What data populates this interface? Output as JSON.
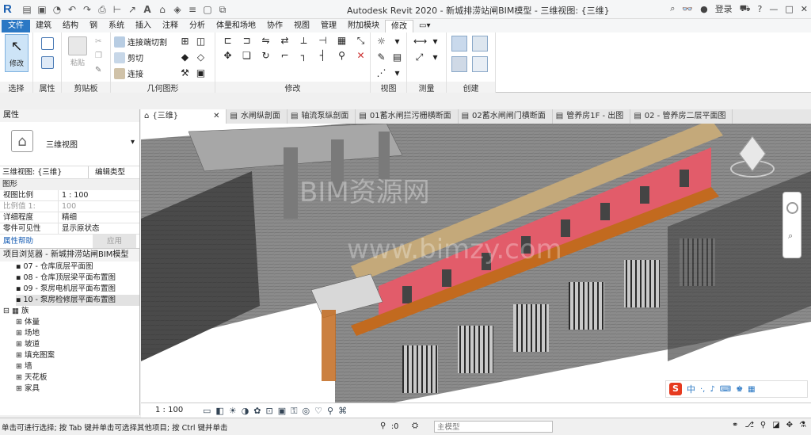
{
  "app": {
    "title": "Autodesk Revit 2020 - 新城排涝站闸BIM模型 - 三维视图: {三维}",
    "logo": "R",
    "user": "登录"
  },
  "ribbon_tabs": [
    "文件",
    "建筑",
    "结构",
    "钢",
    "系统",
    "插入",
    "注释",
    "分析",
    "体量和场地",
    "协作",
    "视图",
    "管理",
    "附加模块",
    "修改"
  ],
  "ribbon": {
    "select_label": "修改",
    "select_panel": "选择",
    "props_panel": "属性",
    "clipboard_paste": "粘贴",
    "clipboard_panel": "剪贴板",
    "geom_items": [
      "连接端切割",
      "剪切",
      "连接"
    ],
    "geom_panel": "几何图形",
    "modify_panel": "修改",
    "view_panel": "视图",
    "measure_panel": "测量",
    "create_panel": "创建"
  },
  "view_tabs": [
    "{三维}",
    "水闸纵剖面",
    "轴流泵纵剖面",
    "01蓄水闸拦污栅横断面",
    "02蓄水闸闸门横断面",
    "管养房1F - 出图",
    "02 - 管养房二层平面图"
  ],
  "properties": {
    "header": "属性",
    "type_name": "三维视图",
    "selector": "三维视图: {三维}",
    "edit_type": "编辑类型",
    "group": "图形",
    "rows": [
      {
        "k": "视图比例",
        "v": "1 : 100"
      },
      {
        "k": "比例值 1:",
        "v": "100"
      },
      {
        "k": "详细程度",
        "v": "精细"
      },
      {
        "k": "零件可见性",
        "v": "显示原状态"
      }
    ],
    "help": "属性帮助",
    "apply": "应用"
  },
  "browser": {
    "title": "项目浏览器 - 新城排涝站闸BIM模型",
    "items": [
      "07 - 仓库底层平面图",
      "08 - 仓库顶层梁平面布置图",
      "09 - 泵房电机层平面布置图",
      "10 - 泵房检修层平面布置图"
    ],
    "family_root": "族",
    "families": [
      "体量",
      "场地",
      "坡道",
      "填充图案",
      "墙",
      "天花板",
      "家具"
    ]
  },
  "watermark": {
    "cn": "BIM资源网",
    "url": "www.bimzy.com"
  },
  "view_control": {
    "scale": "1 : 100"
  },
  "status": {
    "hint": "单击可进行选择; 按 Tab 键并单击可选择其他项目; 按 Ctrl 键并单击",
    "model": "主模型",
    "zero": ":0"
  },
  "ime": {
    "lang": "中"
  },
  "colors": {
    "accent": "#2b78c4",
    "wall": "#e25c6a",
    "rail": "#c26a1f"
  }
}
